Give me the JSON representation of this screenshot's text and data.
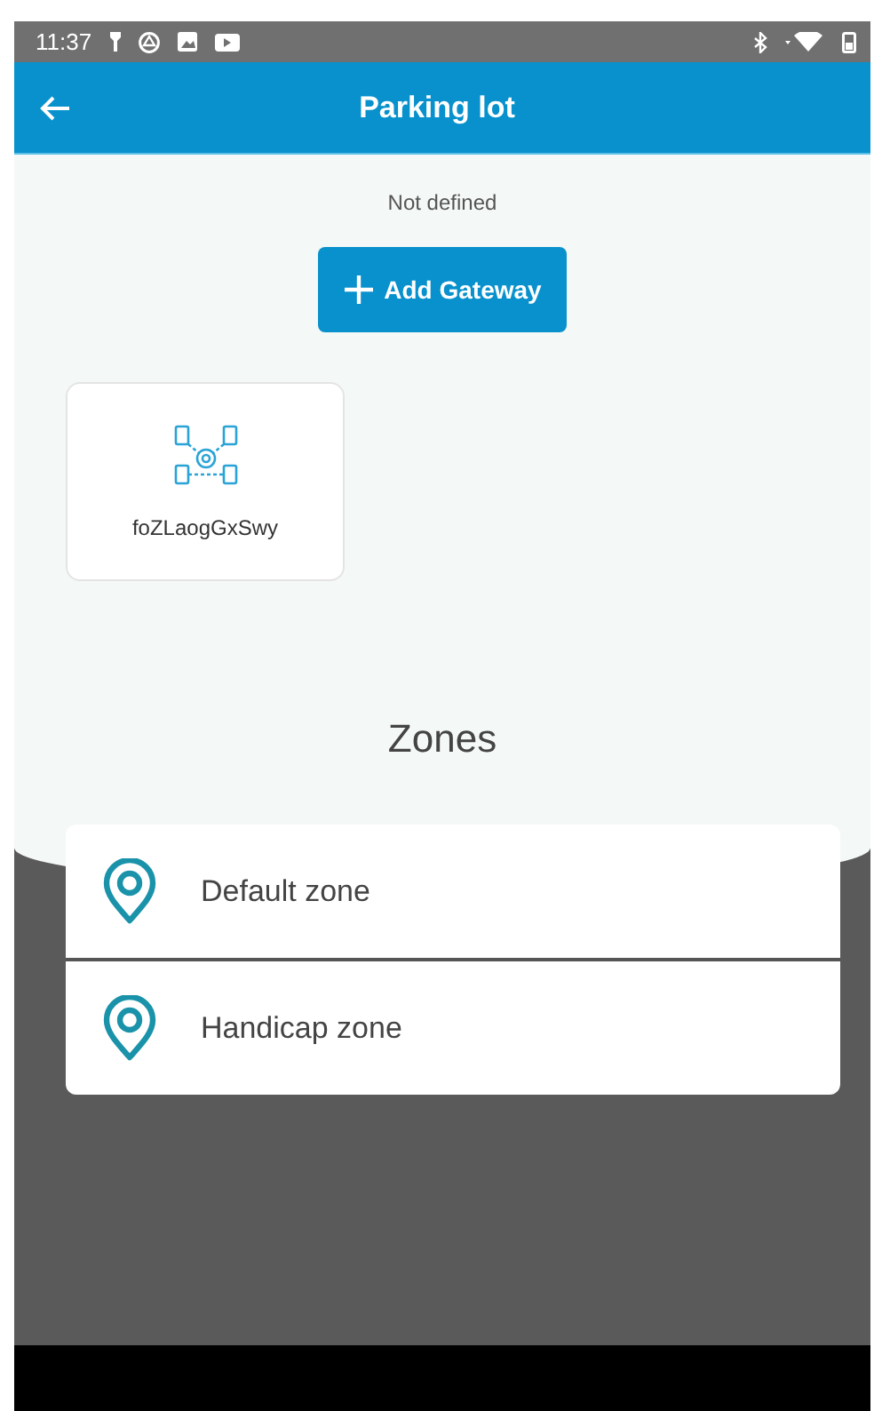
{
  "status_bar": {
    "time": "11:37"
  },
  "app_bar": {
    "title": "Parking lot"
  },
  "gateway_section": {
    "status": "Not defined",
    "add_button": "Add Gateway"
  },
  "gateways": [
    {
      "name": "foZLaogGxSwy"
    }
  ],
  "zones": {
    "title": "Zones",
    "items": [
      {
        "name": "Default zone"
      },
      {
        "name": "Handicap zone"
      }
    ]
  }
}
